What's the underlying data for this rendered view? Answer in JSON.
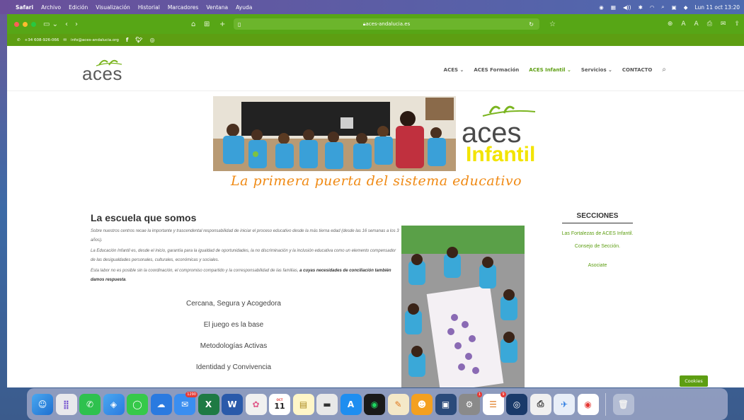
{
  "menubar": {
    "app": "Safari",
    "items": [
      "Archivo",
      "Edición",
      "Visualización",
      "Historial",
      "Marcadores",
      "Ventana",
      "Ayuda"
    ],
    "clock": "Lun 11 oct  13:20"
  },
  "browser": {
    "url": "aces-andalucia.es"
  },
  "contact": {
    "phone": "+34 608-926-066",
    "email": "info@aces-andalucia.org"
  },
  "site": {
    "logo_text": "aces",
    "nav": [
      {
        "label": "ACES ⌄"
      },
      {
        "label": "ACES Formación"
      },
      {
        "label": "ACES Infantil ⌄"
      },
      {
        "label": "Servicios ⌄"
      },
      {
        "label": "CONTACTO"
      }
    ],
    "hero_brand_top": "aces",
    "hero_brand_bottom": "Infantil",
    "tagline": "La primera puerta del sistema educativo",
    "main": {
      "title": "La escuela que somos",
      "para1": "Sobre nuestros centros recae la importante y trascendental responsabilidad de iniciar el proceso educativo desde la más tierna edad (desde las 16 semanas a los 3 años).",
      "para2": "La Educación Infantil es, desde el inicio,  garantía para la igualdad de oportunidades, la no discriminación y la inclusión educativa como un elemento compensador de las desigualdades personales, culturales, económicas y sociales.",
      "para3_plain": "Esta labor no es posible sin la coordinación, el compromiso compartido y la corresponsabilidad de las familias, ",
      "para3_bold": "a cuyas necesidades de conciliación también damos respuesta",
      "features": [
        "Cercana, Segura y Acogedora",
        "El juego es la base",
        "Metodologías Activas",
        "Identidad y Convivencia"
      ]
    },
    "sections": {
      "title": "SECCIONES",
      "links": [
        "Las Fortalezas de ACES Infantil.",
        "Consejo de Sección.",
        "Asociate"
      ]
    },
    "cookies": "Cookies"
  },
  "dock": {
    "mail_badge": "1290",
    "calendar_month": "OCT",
    "calendar_day": "11",
    "settings_badge": "1",
    "reminders_badge": "9"
  }
}
